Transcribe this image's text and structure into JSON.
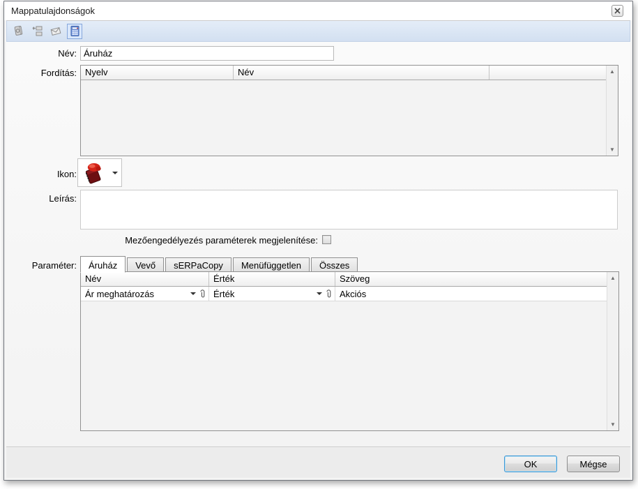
{
  "window": {
    "title": "Mappatulajdonságok"
  },
  "toolbar": {
    "icons": [
      "contacts-icon",
      "move-item-icon",
      "mail-icon",
      "calculator-icon"
    ],
    "selected_icon": "calculator-icon"
  },
  "form": {
    "name_label": "Név:",
    "name_value": "Áruház",
    "translation_label": "Fordítás:",
    "icon_label": "Ikon:",
    "description_label": "Leírás:",
    "description_value": "",
    "field_permission_label": "Mezőengedélyezés paraméterek megjelenítése:",
    "field_permission_checked": false,
    "parameter_label": "Paraméter:"
  },
  "translation_table": {
    "columns": [
      "Nyelv",
      "Név",
      ""
    ],
    "rows": []
  },
  "tabs": [
    {
      "label": "Áruház",
      "active": true
    },
    {
      "label": "Vevő",
      "active": false
    },
    {
      "label": "sERPaCopy",
      "active": false
    },
    {
      "label": "Menüfüggetlen",
      "active": false
    },
    {
      "label": "Összes",
      "active": false
    }
  ],
  "parameter_table": {
    "columns": [
      "Név",
      "Érték",
      "Szöveg"
    ],
    "rows": [
      {
        "name": "Ár meghatározás",
        "value": "Érték",
        "text": "Akciós"
      }
    ]
  },
  "footer": {
    "ok_label": "OK",
    "cancel_label": "Mégse"
  },
  "colors": {
    "toolbar_bg": "#d9e4f3",
    "selected_icon_bg": "#d9e7fb",
    "selected_icon_border": "#86a7dc",
    "ok_focus_border": "#3c97d6",
    "folder_icon_red": "#c41f1a"
  }
}
